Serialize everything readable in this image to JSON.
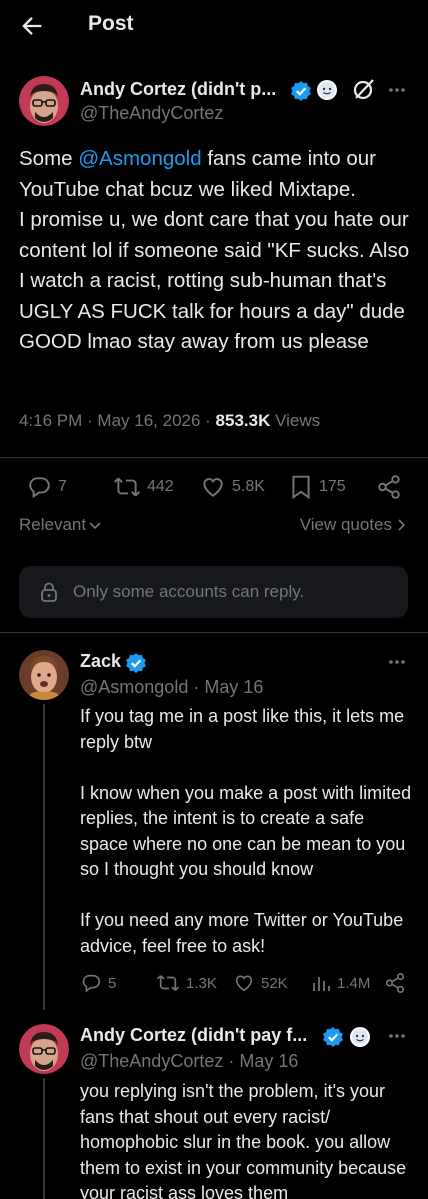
{
  "header": {
    "title": "Post"
  },
  "post": {
    "name": "Andy Cortez (didn't p...",
    "handle": "@TheAndyCortez",
    "text_before_mention": "Some ",
    "mention": "@Asmongold",
    "text_after_mention": " fans came into our YouTube chat bcuz we liked Mixtape.\nI promise u, we dont care that you hate our content lol if someone said \"KF sucks. Also I watch a racist, rotting sub-human that's UGLY AS FUCK talk for hours a day\" dude GOOD lmao stay away from us please",
    "time": "4:16 PM",
    "date": "May 16, 2026",
    "views_count": "853.3K",
    "views_label": "Views",
    "replies": "7",
    "reposts": "442",
    "likes": "5.8K",
    "bookmarks": "175",
    "sort_label": "Relevant",
    "view_quotes": "View quotes",
    "reply_restriction": "Only some accounts can reply."
  },
  "replies": [
    {
      "name": "Zack",
      "handle": "@Asmongold",
      "date": "May 16",
      "text": "If you tag me in a post like this, it lets me reply btw\n\nI know when you make a post with limited replies, the intent is to create a safe space where no one can be mean to you so I thought you should know\n\nIf you need any more Twitter or YouTube advice, feel free to ask!",
      "replies": "5",
      "reposts": "1.3K",
      "likes": "52K",
      "views": "1.4M"
    },
    {
      "name": "Andy Cortez (didn't pay f...",
      "handle": "@TheAndyCortez",
      "date": "May 16",
      "text": "you replying isn't the problem, it's your fans that shout out every racist/ homophobic slur in the book. you allow them to exist in your community because your racist ass loves them"
    }
  ],
  "icons": {
    "back": "arrow-left-icon",
    "verified": "verified-badge-icon",
    "grok": "grok-icon",
    "more": "more-dots-icon",
    "reply": "reply-bubble-icon",
    "repost": "repost-icon",
    "like": "heart-icon",
    "bookmark": "bookmark-icon",
    "share": "share-icon",
    "lock": "lock-icon",
    "analytics": "analytics-icon"
  },
  "colors": {
    "background": "#000000",
    "text": "#e7e9ea",
    "muted": "#71767b",
    "accent": "#1d9bf0",
    "divider": "#2f3336"
  }
}
